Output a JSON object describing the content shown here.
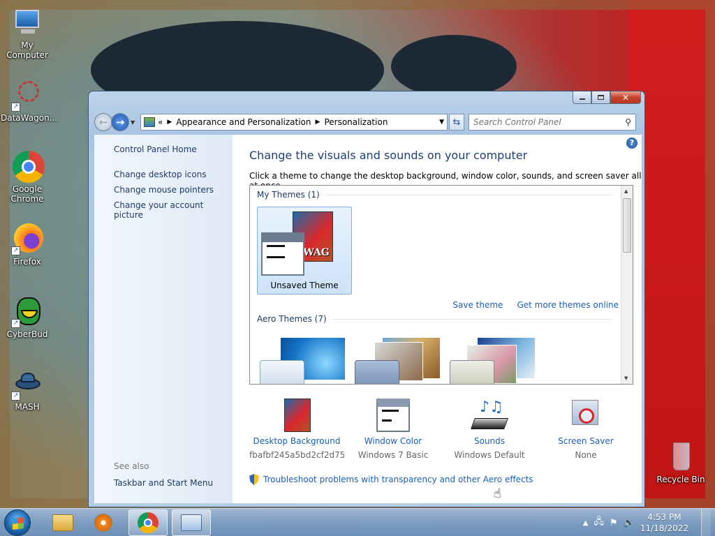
{
  "desktop": {
    "icons": [
      {
        "label": "My Computer",
        "icon": "computer-icon"
      },
      {
        "label": "DataWagon...",
        "icon": "datawagon-icon"
      },
      {
        "label": "Google Chrome",
        "icon": "chrome-icon"
      },
      {
        "label": "Firefox",
        "icon": "firefox-icon"
      },
      {
        "label": "CyberBud",
        "icon": "cyberbud-icon"
      },
      {
        "label": "MASH",
        "icon": "mash-icon"
      },
      {
        "label": "Recycle Bin",
        "icon": "recycle-bin-icon"
      }
    ]
  },
  "window": {
    "breadcrumb": {
      "prefix": "«",
      "items": [
        "Appearance and Personalization",
        "Personalization"
      ]
    },
    "search": {
      "placeholder": "Search Control Panel"
    },
    "left": {
      "home": "Control Panel Home",
      "links": [
        "Change desktop icons",
        "Change mouse pointers",
        "Change your account picture"
      ],
      "see_also": "See also",
      "see_also_links": [
        "Taskbar and Start Menu"
      ]
    },
    "main": {
      "title": "Change the visuals and sounds on your computer",
      "subtitle": "Click a theme to change the desktop background, window color, sounds, and screen saver all at once.",
      "my_themes_header": "My Themes (1)",
      "selected_theme": "Unsaved Theme",
      "swag_text": "SWAG",
      "save_theme": "Save theme",
      "get_more": "Get more themes online",
      "aero_header": "Aero Themes (7)"
    },
    "settings": [
      {
        "title": "Desktop Background",
        "value": "fbafbf245a5bd2cf2d750..."
      },
      {
        "title": "Window Color",
        "value": "Windows 7 Basic"
      },
      {
        "title": "Sounds",
        "value": "Windows Default"
      },
      {
        "title": "Screen Saver",
        "value": "None"
      }
    ],
    "troubleshoot": "Troubleshoot problems with transparency and other Aero effects"
  },
  "taskbar": {
    "clock_time": "4:53 PM",
    "clock_date": "11/18/2022"
  }
}
